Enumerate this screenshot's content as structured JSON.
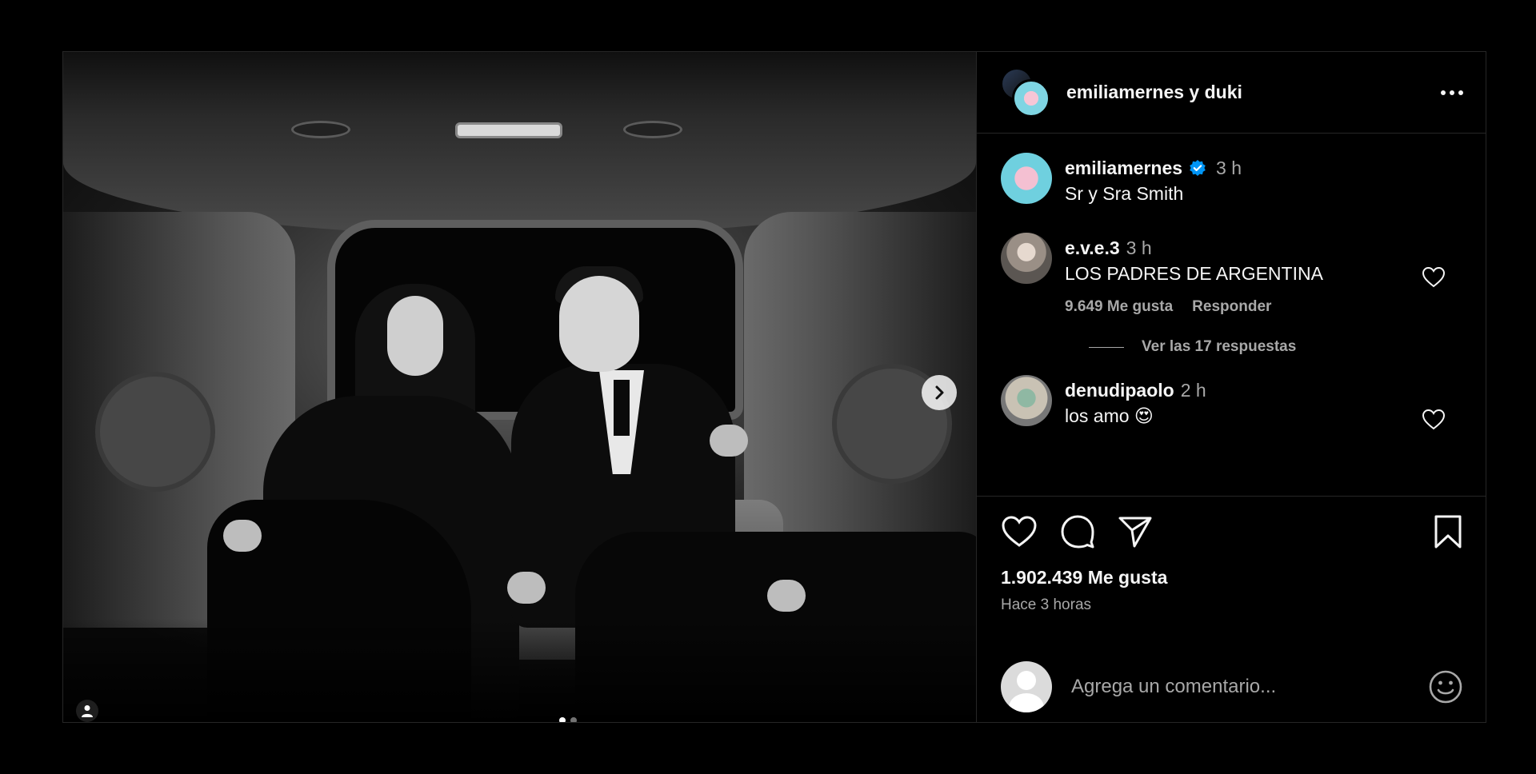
{
  "header": {
    "title": "emiliamernes y duki",
    "more_icon": "more-horizontal-icon"
  },
  "caption": {
    "username": "emiliamernes",
    "verified": true,
    "time": "3 h",
    "text": "Sr y Sra Smith"
  },
  "comments": [
    {
      "username": "e.v.e.3",
      "time": "3 h",
      "text": "LOS PADRES DE ARGENTINA",
      "likes_label": "9.649 Me gusta",
      "reply_label": "Responder",
      "view_replies": "Ver las 17 respuestas"
    },
    {
      "username": "denudipaolo",
      "time": "2 h",
      "text": "los amo 😍"
    }
  ],
  "stats": {
    "likes": "1.902.439 Me gusta",
    "posted": "Hace 3 horas"
  },
  "composer": {
    "placeholder": "Agrega un comentario..."
  },
  "carousel": {
    "current": 1,
    "total": 2
  },
  "colors": {
    "background": "#000000",
    "text_primary": "#f5f5f5",
    "text_secondary": "#a8a8a8",
    "verified": "#0095f6",
    "divider": "#262626"
  }
}
